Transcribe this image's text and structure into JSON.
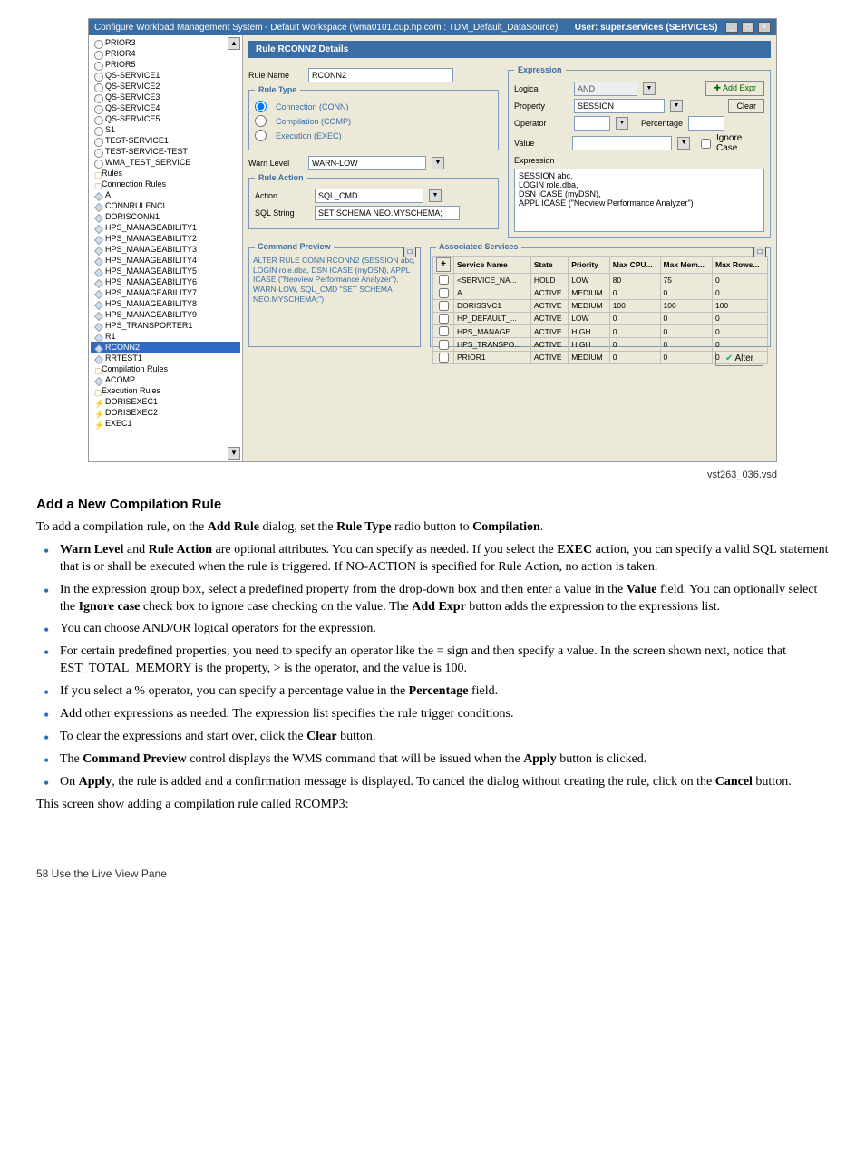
{
  "window": {
    "title": "Configure Workload Management System - Default Workspace (wma0101.cup.hp.com : TDM_Default_DataSource)",
    "user": "User: super.services (SERVICES)"
  },
  "tree": {
    "items": [
      {
        "label": "PRIOR3",
        "cls": ""
      },
      {
        "label": "PRIOR4",
        "cls": ""
      },
      {
        "label": "PRIOR5",
        "cls": ""
      },
      {
        "label": "QS-SERVICE1",
        "cls": ""
      },
      {
        "label": "QS-SERVICE2",
        "cls": ""
      },
      {
        "label": "QS-SERVICE3",
        "cls": ""
      },
      {
        "label": "QS-SERVICE4",
        "cls": ""
      },
      {
        "label": "QS-SERVICE5",
        "cls": ""
      },
      {
        "label": "S1",
        "cls": ""
      },
      {
        "label": "TEST-SERVICE1",
        "cls": ""
      },
      {
        "label": "TEST-SERVICE-TEST",
        "cls": ""
      },
      {
        "label": "WMA_TEST_SERVICE",
        "cls": ""
      },
      {
        "label": "Rules",
        "cls": "folder"
      },
      {
        "label": "Connection Rules",
        "cls": "folder"
      },
      {
        "label": "A",
        "cls": "rule-ic"
      },
      {
        "label": "CONNRULENCI",
        "cls": "rule-ic"
      },
      {
        "label": "DORISCONN1",
        "cls": "rule-ic"
      },
      {
        "label": "HPS_MANAGEABILITY1",
        "cls": "rule-ic"
      },
      {
        "label": "HPS_MANAGEABILITY2",
        "cls": "rule-ic"
      },
      {
        "label": "HPS_MANAGEABILITY3",
        "cls": "rule-ic"
      },
      {
        "label": "HPS_MANAGEABILITY4",
        "cls": "rule-ic"
      },
      {
        "label": "HPS_MANAGEABILITY5",
        "cls": "rule-ic"
      },
      {
        "label": "HPS_MANAGEABILITY6",
        "cls": "rule-ic"
      },
      {
        "label": "HPS_MANAGEABILITY7",
        "cls": "rule-ic"
      },
      {
        "label": "HPS_MANAGEABILITY8",
        "cls": "rule-ic"
      },
      {
        "label": "HPS_MANAGEABILITY9",
        "cls": "rule-ic"
      },
      {
        "label": "HPS_TRANSPORTER1",
        "cls": "rule-ic"
      },
      {
        "label": "R1",
        "cls": "rule-ic"
      },
      {
        "label": "RCONN2",
        "cls": "rule-ic sel"
      },
      {
        "label": "RRTEST1",
        "cls": "rule-ic"
      },
      {
        "label": "Compilation Rules",
        "cls": "folder"
      },
      {
        "label": "ACOMP",
        "cls": "rule-ic"
      },
      {
        "label": "Execution Rules",
        "cls": "folder"
      },
      {
        "label": "DORISEXEC1",
        "cls": "exec"
      },
      {
        "label": "DORISEXEC2",
        "cls": "exec"
      },
      {
        "label": "EXEC1",
        "cls": "exec"
      }
    ]
  },
  "details": {
    "header": "Rule RCONN2 Details",
    "ruleNameLabel": "Rule Name",
    "ruleName": "RCONN2",
    "ruleTypeLegend": "Rule Type",
    "rtConn": "Connection (CONN)",
    "rtComp": "Compilation (COMP)",
    "rtExec": "Execution (EXEC)",
    "warnLevelLabel": "Warn Level",
    "warnLevel": "WARN-LOW",
    "ruleActionLegend": "Rule Action",
    "actionLabel": "Action",
    "action": "SQL_CMD",
    "sqlStringLabel": "SQL String",
    "sqlString": "SET SCHEMA NEO.MYSCHEMA;"
  },
  "expr": {
    "legend": "Expression",
    "logicalLabel": "Logical",
    "logical": "AND",
    "propertyLabel": "Property",
    "property": "SESSION",
    "operatorLabel": "Operator",
    "percLabel": "Percentage",
    "valueLabel": "Value",
    "ignoreLabel": "Ignore Case",
    "addExpr": "Add Expr",
    "clear": "Clear",
    "exprLabel": "Expression",
    "text": "SESSION abc,\n    LOGIN role.dba,\n    DSN ICASE (myDSN),\n    APPL ICASE (\"Neoview Performance Analyzer\")"
  },
  "cmdprev": {
    "legend": "Command Preview",
    "text": "ALTER RULE CONN RCONN2 (SESSION abc,   LOGIN role.dba,   DSN ICASE (myDSN),   APPL ICASE (\"Neoview Performance Analyzer\"), WARN-LOW, SQL_CMD \"SET SCHEMA NEO.MYSCHEMA;\")"
  },
  "assoc": {
    "legend": "Associated Services",
    "headers": [
      "+",
      "Service Name",
      "State",
      "Priority",
      "Max CPU...",
      "Max Mem...",
      "Max Rows..."
    ],
    "rows": [
      {
        "name": "<SERVICE_NA...",
        "state": "HOLD",
        "prio": "LOW",
        "cpu": "80",
        "mem": "75",
        "rows": "0"
      },
      {
        "name": "A",
        "state": "ACTIVE",
        "prio": "MEDIUM",
        "cpu": "0",
        "mem": "0",
        "rows": "0"
      },
      {
        "name": "DORISSVC1",
        "state": "ACTIVE",
        "prio": "MEDIUM",
        "cpu": "100",
        "mem": "100",
        "rows": "100"
      },
      {
        "name": "HP_DEFAULT_...",
        "state": "ACTIVE",
        "prio": "LOW",
        "cpu": "0",
        "mem": "0",
        "rows": "0"
      },
      {
        "name": "HPS_MANAGE...",
        "state": "ACTIVE",
        "prio": "HIGH",
        "cpu": "0",
        "mem": "0",
        "rows": "0"
      },
      {
        "name": "HPS_TRANSPO...",
        "state": "ACTIVE",
        "prio": "HIGH",
        "cpu": "0",
        "mem": "0",
        "rows": "0"
      },
      {
        "name": "PRIOR1",
        "state": "ACTIVE",
        "prio": "MEDIUM",
        "cpu": "0",
        "mem": "0",
        "rows": "0"
      }
    ]
  },
  "alterBtn": "Alter",
  "caption": "vst263_036.vsd",
  "doc": {
    "heading": "Add a New Compilation Rule",
    "intro": "To add a compilation rule, on the Add Rule dialog, set the Rule Type radio button to Compilation.",
    "bullets": [
      "Warn Level and Rule Action are optional attributes. You can specify as needed. If you select the EXEC action, you can specify a valid SQL statement that is or shall be executed when the rule is triggered. If NO-ACTION is specified for Rule Action, no action is taken.",
      "In the expression group box, select a predefined property from the drop-down box and then enter a value in the Value field. You can optionally select the Ignore case check box to ignore case checking on the value. The Add Expr button adds the expression to the expressions list.",
      "You can choose AND/OR logical operators for the expression.",
      "For certain predefined properties, you need to specify an operator like the = sign and then specify a value. In the screen shown next, notice that EST_TOTAL_MEMORY is the property, > is the operator, and the value is 100.",
      "If you select a % operator, you can specify a percentage value in the Percentage field.",
      "Add other expressions as needed. The expression list specifies the rule trigger conditions.",
      "To clear the expressions and start over, click the Clear button.",
      "The Command Preview control displays the WMS command that will be issued when the Apply button is clicked.",
      "On Apply, the rule is added and a confirmation message is displayed. To cancel the dialog without creating the rule, click on the Cancel button."
    ],
    "closing": "This screen show adding a compilation rule called RCOMP3:",
    "footer": "58     Use the Live View Pane"
  }
}
